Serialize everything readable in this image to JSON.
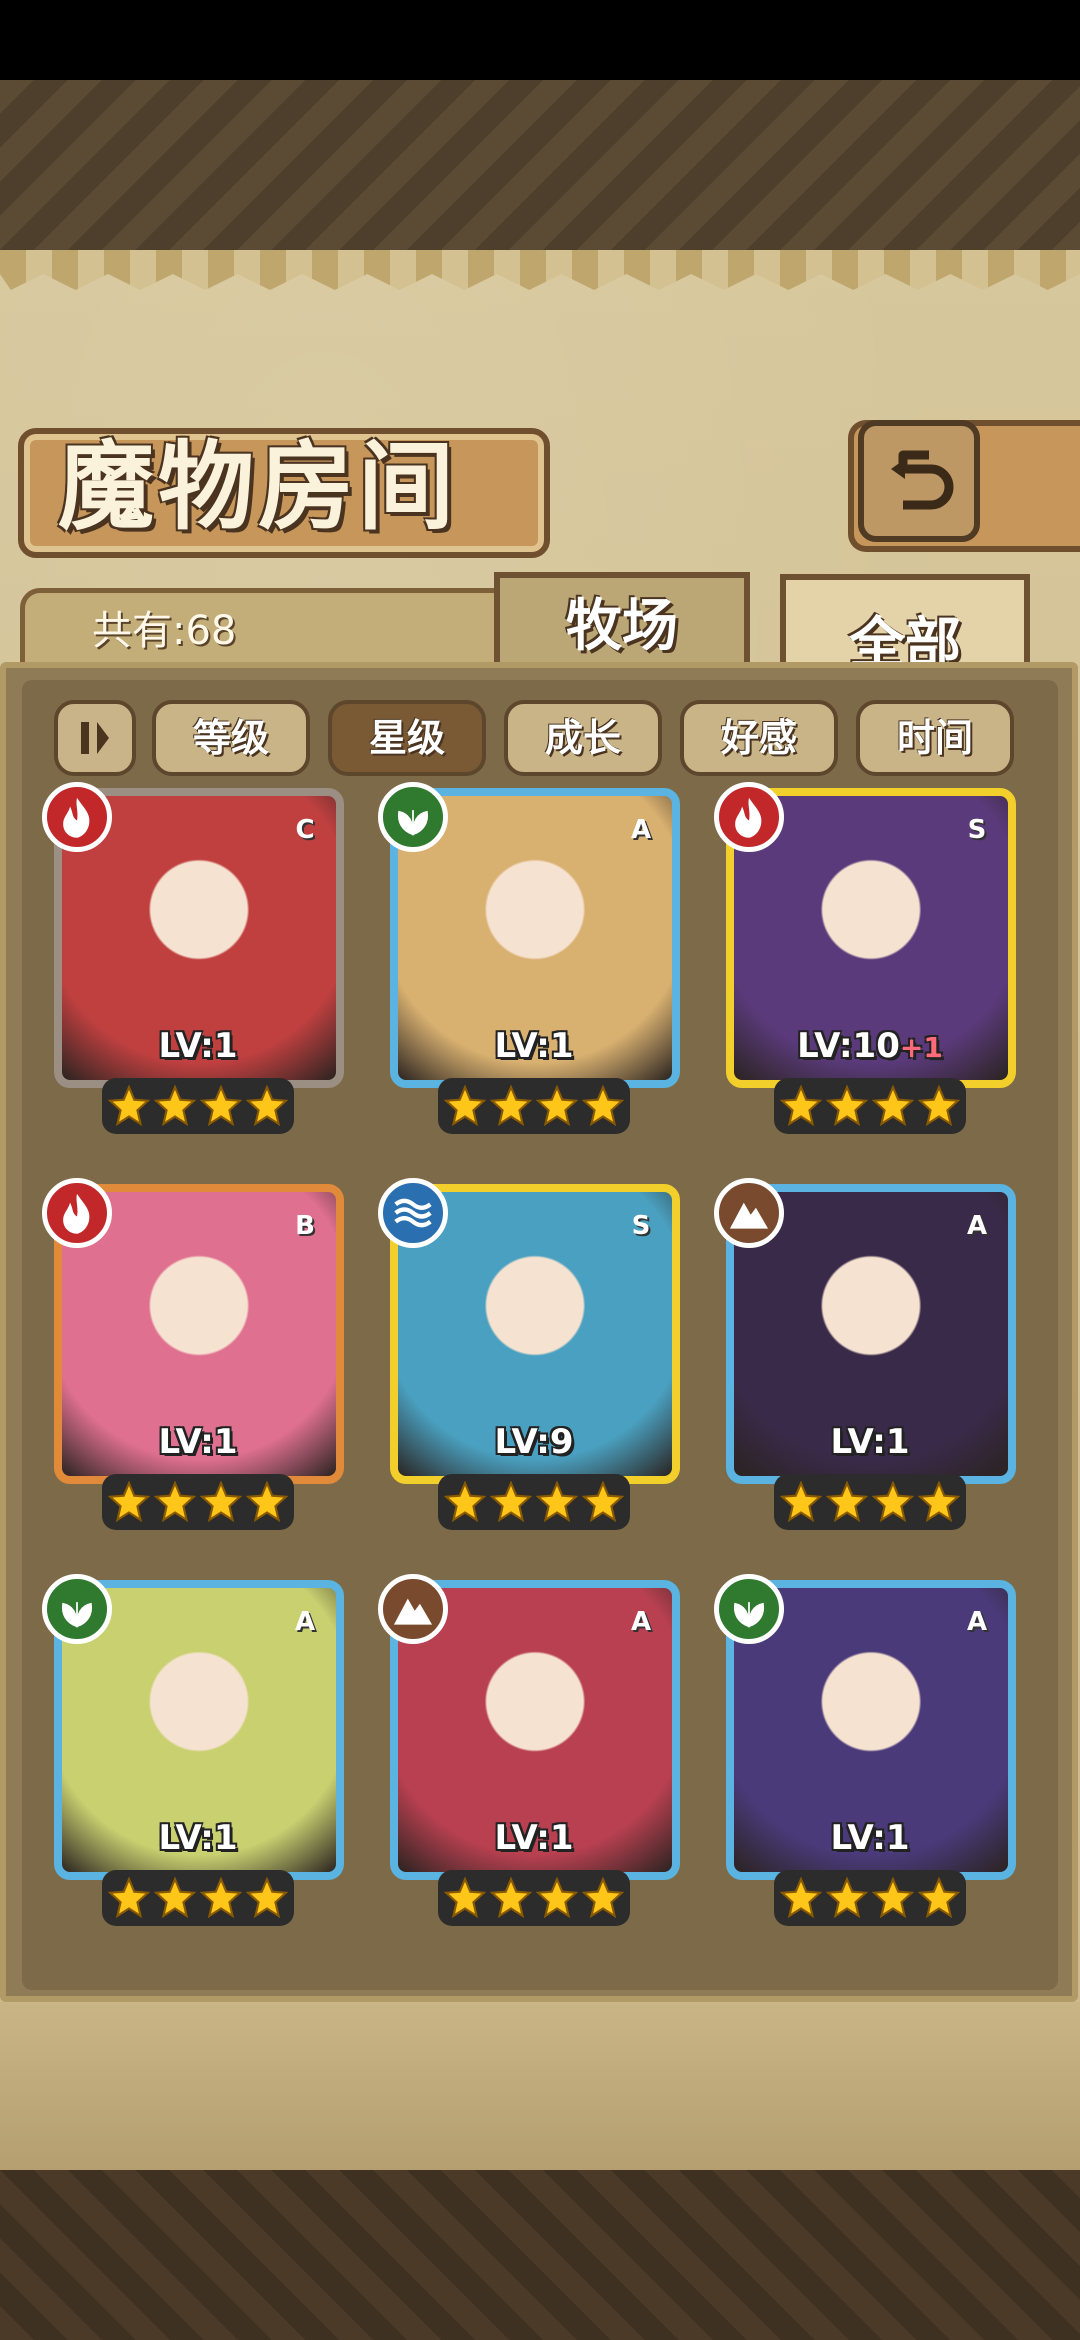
{
  "header": {
    "title": "魔物房间",
    "back_icon": "return-arrow-icon"
  },
  "info": {
    "count_label": "共有:68"
  },
  "tabs": [
    {
      "label": "牧场",
      "active": false
    },
    {
      "label": "全部",
      "active": true
    }
  ],
  "sort": {
    "toggle_icon": "sort-order-icon",
    "buttons": [
      {
        "label": "等级",
        "active": false
      },
      {
        "label": "星级",
        "active": true
      },
      {
        "label": "成长",
        "active": false
      },
      {
        "label": "好感",
        "active": false
      },
      {
        "label": "时间",
        "active": false
      }
    ]
  },
  "monsters": [
    {
      "element": "fire",
      "rank": "C",
      "level": "LV:1",
      "bonus": "",
      "stars": 4,
      "frame": "silver",
      "art": "#c04040"
    },
    {
      "element": "leaf",
      "rank": "A",
      "level": "LV:1",
      "bonus": "",
      "stars": 4,
      "frame": "blue",
      "art": "#d8b070"
    },
    {
      "element": "fire",
      "rank": "S",
      "level": "LV:10",
      "bonus": "+1",
      "stars": 4,
      "frame": "gold",
      "art": "#5a3a7a"
    },
    {
      "element": "fire",
      "rank": "B",
      "level": "LV:1",
      "bonus": "",
      "stars": 4,
      "frame": "bronze",
      "art": "#e07090"
    },
    {
      "element": "water",
      "rank": "S",
      "level": "LV:9",
      "bonus": "",
      "stars": 4,
      "frame": "gold",
      "art": "#4aa0c0"
    },
    {
      "element": "earth",
      "rank": "A",
      "level": "LV:1",
      "bonus": "",
      "stars": 4,
      "frame": "blue",
      "art": "#3a2a4a"
    },
    {
      "element": "leaf",
      "rank": "A",
      "level": "LV:1",
      "bonus": "",
      "stars": 4,
      "frame": "blue",
      "art": "#c8d070"
    },
    {
      "element": "earth",
      "rank": "A",
      "level": "LV:1",
      "bonus": "",
      "stars": 4,
      "frame": "blue",
      "art": "#b84050"
    },
    {
      "element": "leaf",
      "rank": "A",
      "level": "LV:1",
      "bonus": "",
      "stars": 4,
      "frame": "blue",
      "art": "#4a3a7a"
    }
  ],
  "colors": {
    "frame_silver": "#9a8f82",
    "frame_blue": "#5ab3e0",
    "frame_gold": "#f2cf2a",
    "frame_bronze": "#e08a3a",
    "elem_fire": "#c2282a",
    "elem_leaf": "#2f7a2f",
    "elem_water": "#2a6fb0",
    "elem_earth": "#7a4a2e",
    "star": "#ffc61a"
  }
}
